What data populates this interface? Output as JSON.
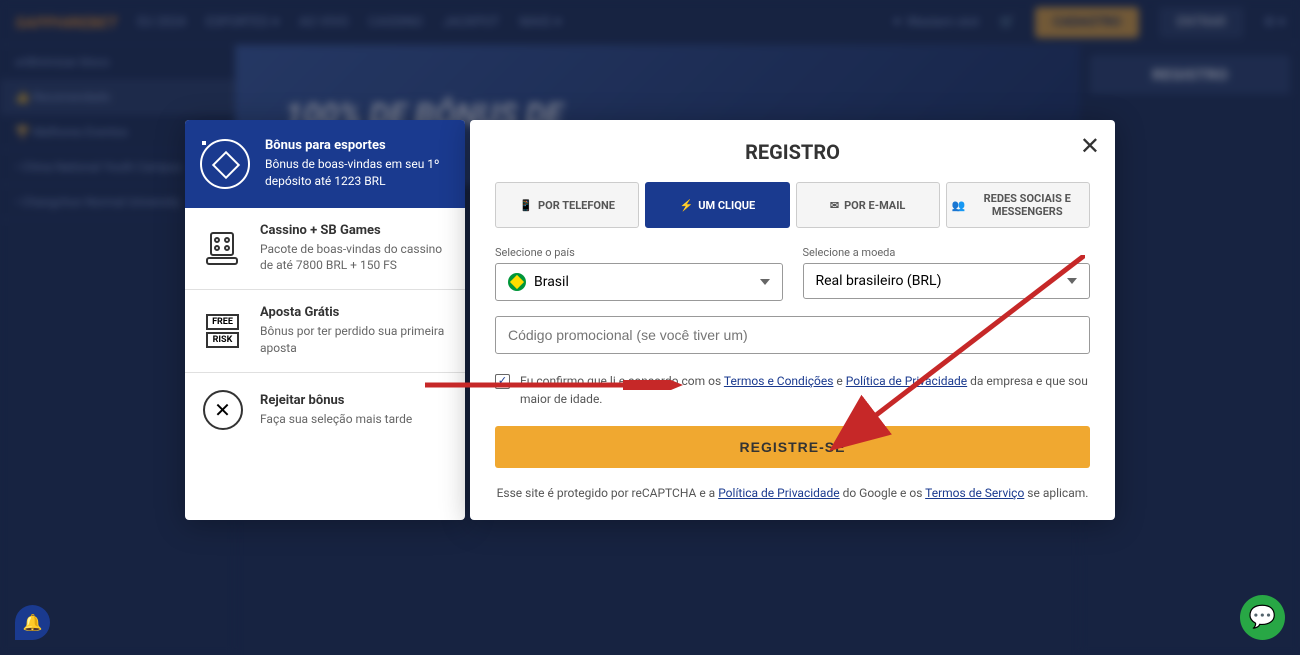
{
  "header": {
    "logo": "SAPPHIREBET",
    "nav": [
      "EU 2024",
      "ESPORTES",
      "AO VIVO",
      "CASSINO",
      "JACKPOT",
      "MAIS"
    ],
    "promo_game": "Western slot",
    "btn_cadastro": "CADASTRO",
    "btn_entrar": "ENTRAR"
  },
  "banner": {
    "title": "100% DE BÔNUS DE"
  },
  "right_panel": {
    "title": "REGISTRO"
  },
  "bonus_panel": {
    "header_title": "Bônus para esportes",
    "header_desc": "Bônus de boas-vindas em seu 1º depósito até 1223 BRL",
    "items": [
      {
        "title": "Cassino + SB Games",
        "desc": "Pacote de boas-vindas do cassino de até 7800 BRL + 150 FS"
      },
      {
        "title": "Aposta Grátis",
        "desc": "Bônus por ter perdido sua primeira aposta"
      },
      {
        "title": "Rejeitar bônus",
        "desc": "Faça sua seleção mais tarde"
      }
    ],
    "free_label": "FREE",
    "risk_label": "RISK"
  },
  "modal": {
    "title": "REGISTRO",
    "tabs": [
      {
        "label": "POR TELEFONE",
        "icon": "📱"
      },
      {
        "label": "UM CLIQUE",
        "icon": "⚡"
      },
      {
        "label": "POR E-MAIL",
        "icon": "✉"
      },
      {
        "label": "REDES SOCIAIS E MESSENGERS",
        "icon": "👥"
      }
    ],
    "country_label": "Selecione o país",
    "country_value": "Brasil",
    "currency_label": "Selecione a moeda",
    "currency_value": "Real brasileiro (BRL)",
    "promo_placeholder": "Código promocional (se você tiver um)",
    "confirm_text_1": "Eu confirmo que li e concordo com os ",
    "terms_link": "Termos e Condições",
    "confirm_text_2": " e ",
    "privacy_link": "Política de Privacidade",
    "confirm_text_3": " da empresa e que sou maior de idade.",
    "register_btn": "REGISTRE-SE",
    "recaptcha_1": "Esse site é protegido por reCAPTCHA e a ",
    "recaptcha_privacy": "Política de Privacidade",
    "recaptcha_2": " do Google e os ",
    "recaptcha_tos": "Termos de Serviço",
    "recaptcha_3": " se aplicam."
  }
}
